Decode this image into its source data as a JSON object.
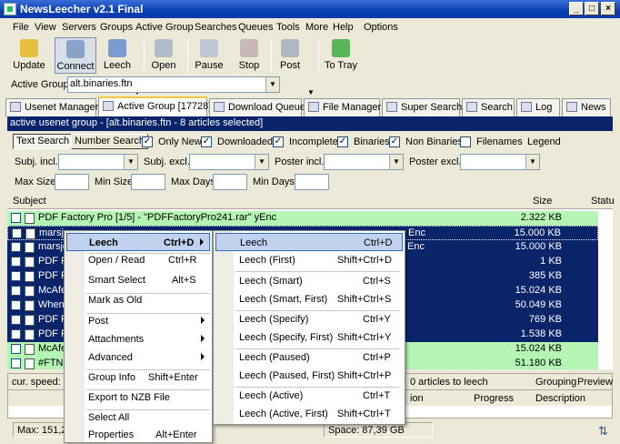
{
  "window": {
    "title": "NewsLeecher v2.1 Final"
  },
  "menubar": [
    "File",
    "View",
    "Servers",
    "Groups",
    "Active Group",
    "Searches",
    "Queues",
    "Tools",
    "More",
    "Help",
    "Options"
  ],
  "toolbar": [
    {
      "label": "Update",
      "icon": "update-icon"
    },
    {
      "label": "Connect",
      "icon": "connect-icon"
    },
    {
      "label": "Leech",
      "icon": "leech-icon"
    },
    {
      "label": "Open",
      "icon": "open-icon"
    },
    {
      "label": "Pause",
      "icon": "pause-icon"
    },
    {
      "label": "Stop",
      "icon": "stop-icon"
    },
    {
      "label": "Post",
      "icon": "post-icon"
    },
    {
      "label": "To Tray",
      "icon": "tray-icon"
    }
  ],
  "active_group": {
    "label": "Active Group",
    "value": "alt.binaries.ftn"
  },
  "tabs": [
    "Usenet Manager",
    "Active Group [17728]",
    "Download Queue",
    "File Manager",
    "Super Search",
    "Search",
    "Log",
    "News"
  ],
  "panel_header": "active usenet group  -  [alt.binaries.ftn  -  8 articles selected]",
  "filters": {
    "text_search": "Text Search",
    "number_search": "Number Search",
    "only_new": "Only New",
    "downloaded": "Downloaded",
    "incomplete": "Incomplete",
    "binaries": "Binaries",
    "non_binaries": "Non Binaries",
    "filenames": "Filenames",
    "legend": "Legend",
    "subj_incl": "Subj. incl.",
    "subj_excl": "Subj. excl.",
    "poster_incl": "Poster incl.",
    "poster_excl": "Poster excl.",
    "max_size": "Max Size",
    "min_size": "Min Size",
    "max_days": "Max Days",
    "min_days": "Min Days"
  },
  "list": {
    "col_subject": "Subject",
    "col_size": "Size",
    "col_status": "Statu",
    "rows": [
      {
        "subject": "PDF Factory Pro [1/5] - \"PDFFactoryPro241.rar\" yEnc",
        "size": "2.322 KB",
        "style": "green"
      },
      {
        "subject": "marsje",
        "tail": "Enc",
        "size": "15.000 KB",
        "style": "sel"
      },
      {
        "subject": "marsje",
        "tail": "Enc",
        "size": "15.000 KB",
        "style": "sel"
      },
      {
        "subject": "PDF F",
        "tail": "",
        "size": "1 KB",
        "style": "sel"
      },
      {
        "subject": "PDF F",
        "tail": "",
        "size": "385 KB",
        "style": "sel"
      },
      {
        "subject": "McAfe",
        "tail": "",
        "size": "15.024 KB",
        "style": "sel"
      },
      {
        "subject": "When",
        "tail": "",
        "size": "50.049 KB",
        "style": "sel"
      },
      {
        "subject": "PDF F",
        "tail": "",
        "size": "769 KB",
        "style": "sel"
      },
      {
        "subject": "PDF F",
        "tail": "",
        "size": "1.538 KB",
        "style": "sel"
      },
      {
        "subject": "McAfe",
        "tail": "",
        "size": "15.024 KB",
        "style": "green"
      },
      {
        "subject": "#FTN3",
        "tail": "",
        "size": "51.180 KB",
        "style": "green"
      }
    ]
  },
  "bottom": {
    "speed": "cur. speed: 0,",
    "articles": "0 articles to leech",
    "grouping": "Grouping",
    "preview": "Preview",
    "col_progress": "Progress",
    "col_description": "Description",
    "col_ion": "ion"
  },
  "statusbar": {
    "max": "Max: 151,2",
    "space": "Space: 87,39 GB"
  },
  "context_menu": [
    {
      "label": "Leech",
      "shortcut": "Ctrl+D",
      "submenu": true,
      "bold": true,
      "highlight": true
    },
    {
      "label": "Open / Read",
      "shortcut": "Ctrl+R"
    },
    {
      "label": "Smart Select",
      "shortcut": "Alt+S"
    },
    {
      "label": "Mark as Old",
      "shortcut": ""
    },
    {
      "label": "Post",
      "shortcut": "",
      "submenu": true
    },
    {
      "label": "Attachments",
      "shortcut": "",
      "submenu": true
    },
    {
      "label": "Advanced",
      "shortcut": "",
      "submenu": true
    },
    {
      "label": "Group Info",
      "shortcut": "Shift+Enter"
    },
    {
      "label": "Export to NZB File",
      "shortcut": ""
    },
    {
      "label": "Select All",
      "shortcut": ""
    },
    {
      "label": "Properties",
      "shortcut": "Alt+Enter"
    }
  ],
  "leech_submenu": [
    {
      "label": "Leech",
      "shortcut": "Ctrl+D"
    },
    {
      "label": "Leech (First)",
      "shortcut": "Shift+Ctrl+D"
    },
    {
      "label": "Leech (Smart)",
      "shortcut": "Ctrl+S"
    },
    {
      "label": "Leech (Smart, First)",
      "shortcut": "Shift+Ctrl+S"
    },
    {
      "label": "Leech (Specify)",
      "shortcut": "Ctrl+Y"
    },
    {
      "label": "Leech (Specify, First)",
      "shortcut": "Shift+Ctrl+Y"
    },
    {
      "label": "Leech (Paused)",
      "shortcut": "Ctrl+P"
    },
    {
      "label": "Leech (Paused, First)",
      "shortcut": "Shift+Ctrl+P"
    },
    {
      "label": "Leech (Active)",
      "shortcut": "Ctrl+T"
    },
    {
      "label": "Leech (Active, First)",
      "shortcut": "Shift+Ctrl+T"
    }
  ],
  "colors": {
    "selection": "#0a246a",
    "green_row": "#b4f5b4",
    "title_bar": "#0a3fb5",
    "menu_highlight": "#c1d2ee"
  }
}
